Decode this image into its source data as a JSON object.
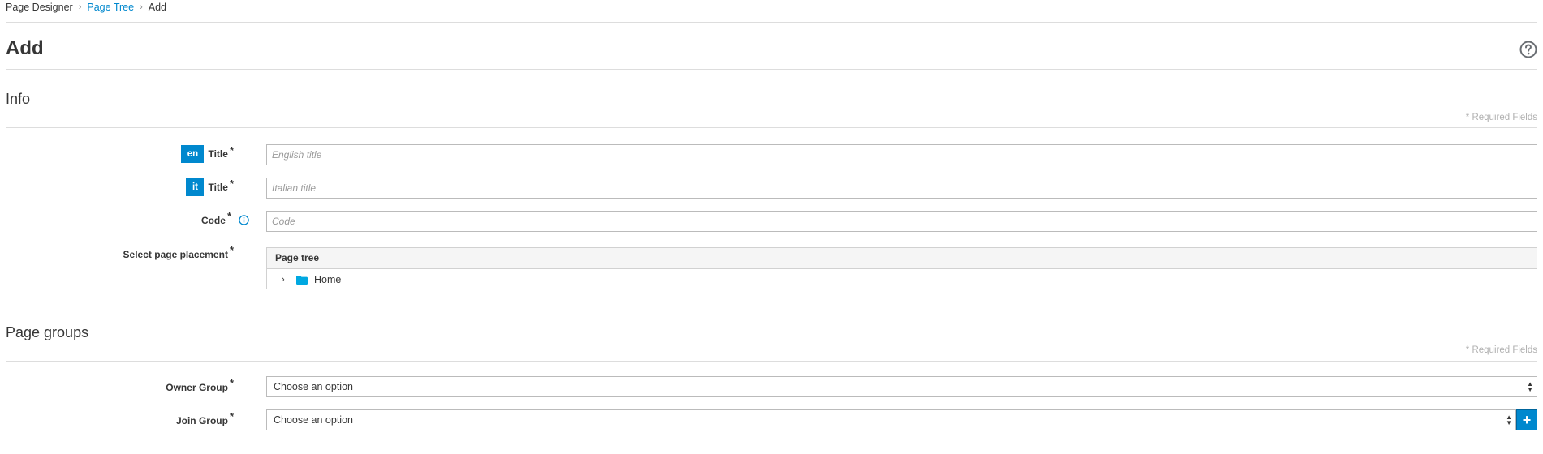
{
  "breadcrumb": {
    "root": "Page Designer",
    "parent": "Page Tree",
    "current": "Add"
  },
  "page": {
    "title": "Add"
  },
  "info_section": {
    "title": "Info",
    "required_note": "* Required Fields",
    "title_en": {
      "lang": "en",
      "label": "Title",
      "required": "*",
      "placeholder": "English title"
    },
    "title_it": {
      "lang": "it",
      "label": "Title",
      "required": "*",
      "placeholder": "Italian title"
    },
    "code": {
      "label": "Code",
      "required": "*",
      "placeholder": "Code"
    },
    "placement": {
      "label": "Select page placement",
      "required": "*",
      "tree_header": "Page tree",
      "tree_root": "Home"
    }
  },
  "groups_section": {
    "title": "Page groups",
    "required_note": "* Required Fields",
    "owner": {
      "label": "Owner Group",
      "required": "*",
      "value": "Choose an option"
    },
    "join": {
      "label": "Join Group",
      "required": "*",
      "value": "Choose an option"
    }
  },
  "colors": {
    "accent": "#0088ce",
    "border": "#bbbbbb",
    "divider": "#dddddd"
  },
  "icons": {
    "help": "question-circle-icon",
    "info": "info-circle-icon",
    "folder": "folder-icon",
    "expand": "chevron-right-icon",
    "add": "plus-icon"
  }
}
